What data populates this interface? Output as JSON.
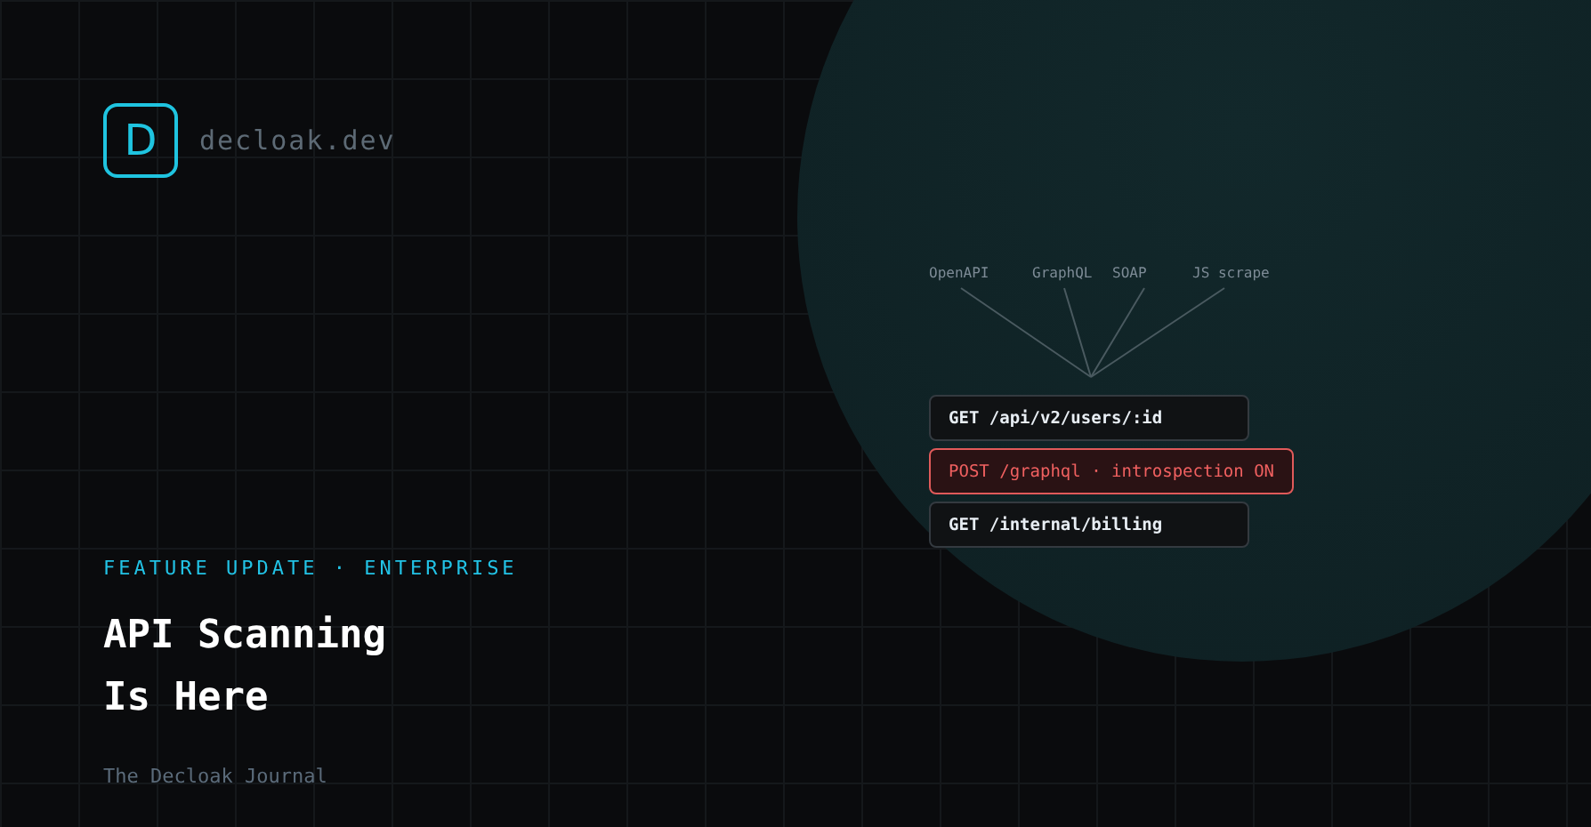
{
  "brand": {
    "logo_letter": "D",
    "name": "decloak.dev"
  },
  "diagram": {
    "sources": [
      "OpenAPI",
      "GraphQL",
      "SOAP",
      "JS scrape"
    ],
    "endpoints": [
      {
        "text": "GET /api/v2/users/:id",
        "flagged": false
      },
      {
        "text": "POST /graphql · introspection ON",
        "flagged": true
      },
      {
        "text": "GET /internal/billing",
        "flagged": false
      }
    ]
  },
  "eyebrow": "FEATURE UPDATE · ENTERPRISE",
  "title_lines": [
    "API Scanning",
    "Is Here"
  ],
  "footer": "The Decloak Journal"
}
